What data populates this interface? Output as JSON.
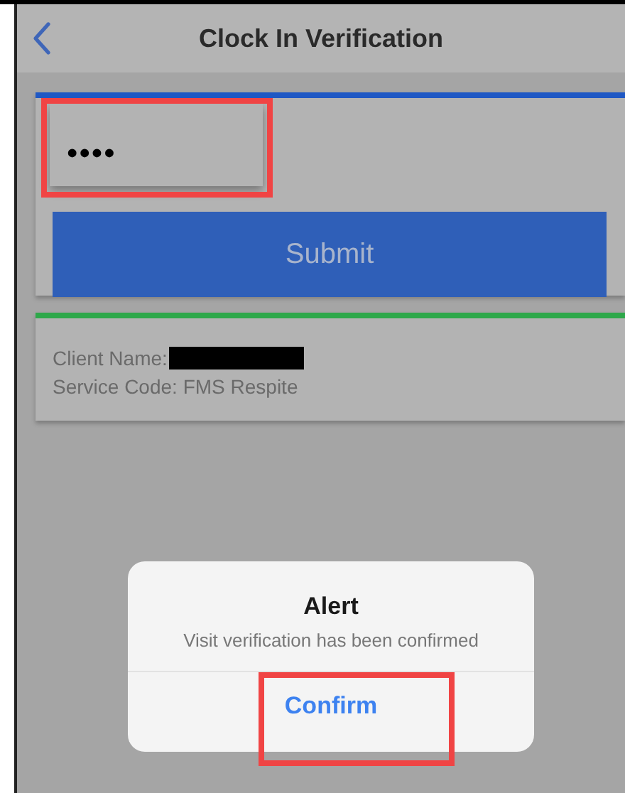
{
  "header": {
    "title": "Clock In Verification"
  },
  "pin_field": {
    "value": "••••",
    "highlighted": true
  },
  "submit_button": {
    "label": "Submit"
  },
  "visit_card": {
    "client_name_label": "Client Name:",
    "service_code": "Service Code: FMS Respite"
  },
  "alert": {
    "title": "Alert",
    "message": "Visit verification has been confirmed",
    "button": {
      "label": "Confirm",
      "highlighted": true
    }
  }
}
